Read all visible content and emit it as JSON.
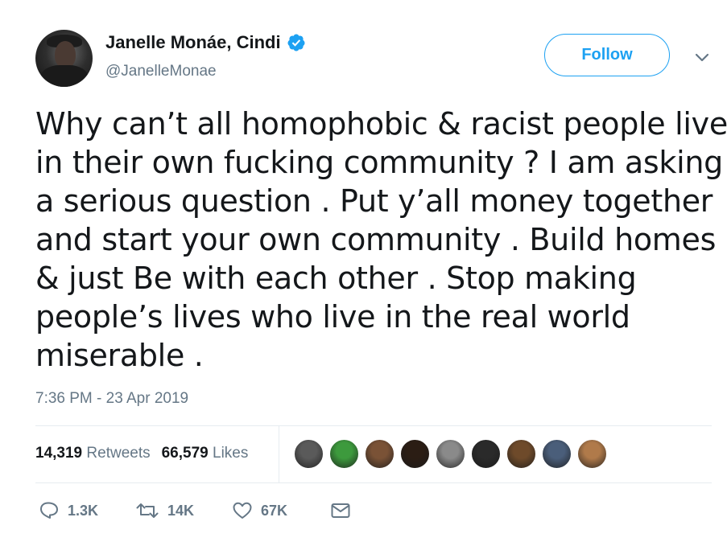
{
  "author": {
    "display_name": "Janelle Monáe, Cindi",
    "handle": "@JanelleMonae",
    "verified": true,
    "avatar_icon": "profile-photo"
  },
  "follow_label": "Follow",
  "tweet": {
    "lines": [
      "Why can’t all homophobic & racist people live",
      "in their own fucking community ? I am asking",
      "a serious question . Put y’all money together",
      "and start your own community . Build homes",
      "& just Be with each other . Stop making",
      "people’s lives who live in the real world",
      "miserable ."
    ],
    "timestamp": "7:36 PM - 23 Apr 2019"
  },
  "stats": {
    "retweets_count": "14,319",
    "retweets_label": "Retweets",
    "likes_count": "66,579",
    "likes_label": "Likes"
  },
  "likers": [
    {
      "icon": "liker-avatar-1",
      "color": "#5a5a5a"
    },
    {
      "icon": "liker-avatar-2",
      "color": "#3d9a3d"
    },
    {
      "icon": "liker-avatar-3",
      "color": "#7a5236"
    },
    {
      "icon": "liker-avatar-4",
      "color": "#2b1d14"
    },
    {
      "icon": "liker-avatar-5",
      "color": "#8a8a8a"
    },
    {
      "icon": "liker-avatar-6",
      "color": "#2a2a2a"
    },
    {
      "icon": "liker-avatar-7",
      "color": "#6e4a2a"
    },
    {
      "icon": "liker-avatar-8",
      "color": "#4a5e7a"
    },
    {
      "icon": "liker-avatar-9",
      "color": "#b07a4a"
    }
  ],
  "actions": {
    "replies": "1.3K",
    "retweets": "14K",
    "likes": "67K"
  },
  "colors": {
    "accent": "#1da1f2",
    "secondary_text": "#657786",
    "text": "#14171a",
    "divider": "#e6ecf0"
  }
}
